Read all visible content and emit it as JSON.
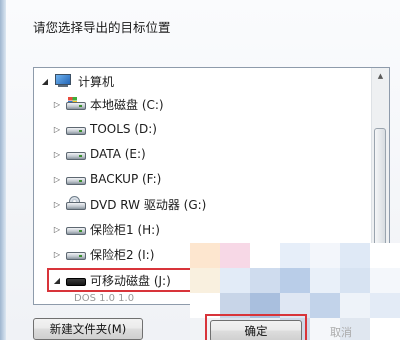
{
  "dialog": {
    "prompt": "请您选择导出的目标位置"
  },
  "tree": {
    "root": {
      "label": "计算机",
      "icon": "computer-icon",
      "expanded": true
    },
    "items": [
      {
        "label": "本地磁盘 (C:)",
        "icon": "system-drive-icon"
      },
      {
        "label": "TOOLS (D:)",
        "icon": "hard-drive-icon"
      },
      {
        "label": "DATA (E:)",
        "icon": "hard-drive-icon"
      },
      {
        "label": "BACKUP (F:)",
        "icon": "hard-drive-icon"
      },
      {
        "label": "DVD RW 驱动器 (G:)",
        "icon": "dvd-drive-icon"
      },
      {
        "label": "保险柜1 (H:)",
        "icon": "hard-drive-icon"
      },
      {
        "label": "保险柜2 (I:)",
        "icon": "hard-drive-icon"
      },
      {
        "label": "可移动磁盘 (J:)",
        "icon": "removable-drive-icon",
        "selected": true,
        "expanded": true
      }
    ],
    "partial_next_row": "DOS  1.0 1.0"
  },
  "buttons": {
    "new_folder": "新建文件夹(M)",
    "ok": "确定",
    "cancel_partial": "取消"
  },
  "colors": {
    "highlight_box": "#d8343a"
  }
}
